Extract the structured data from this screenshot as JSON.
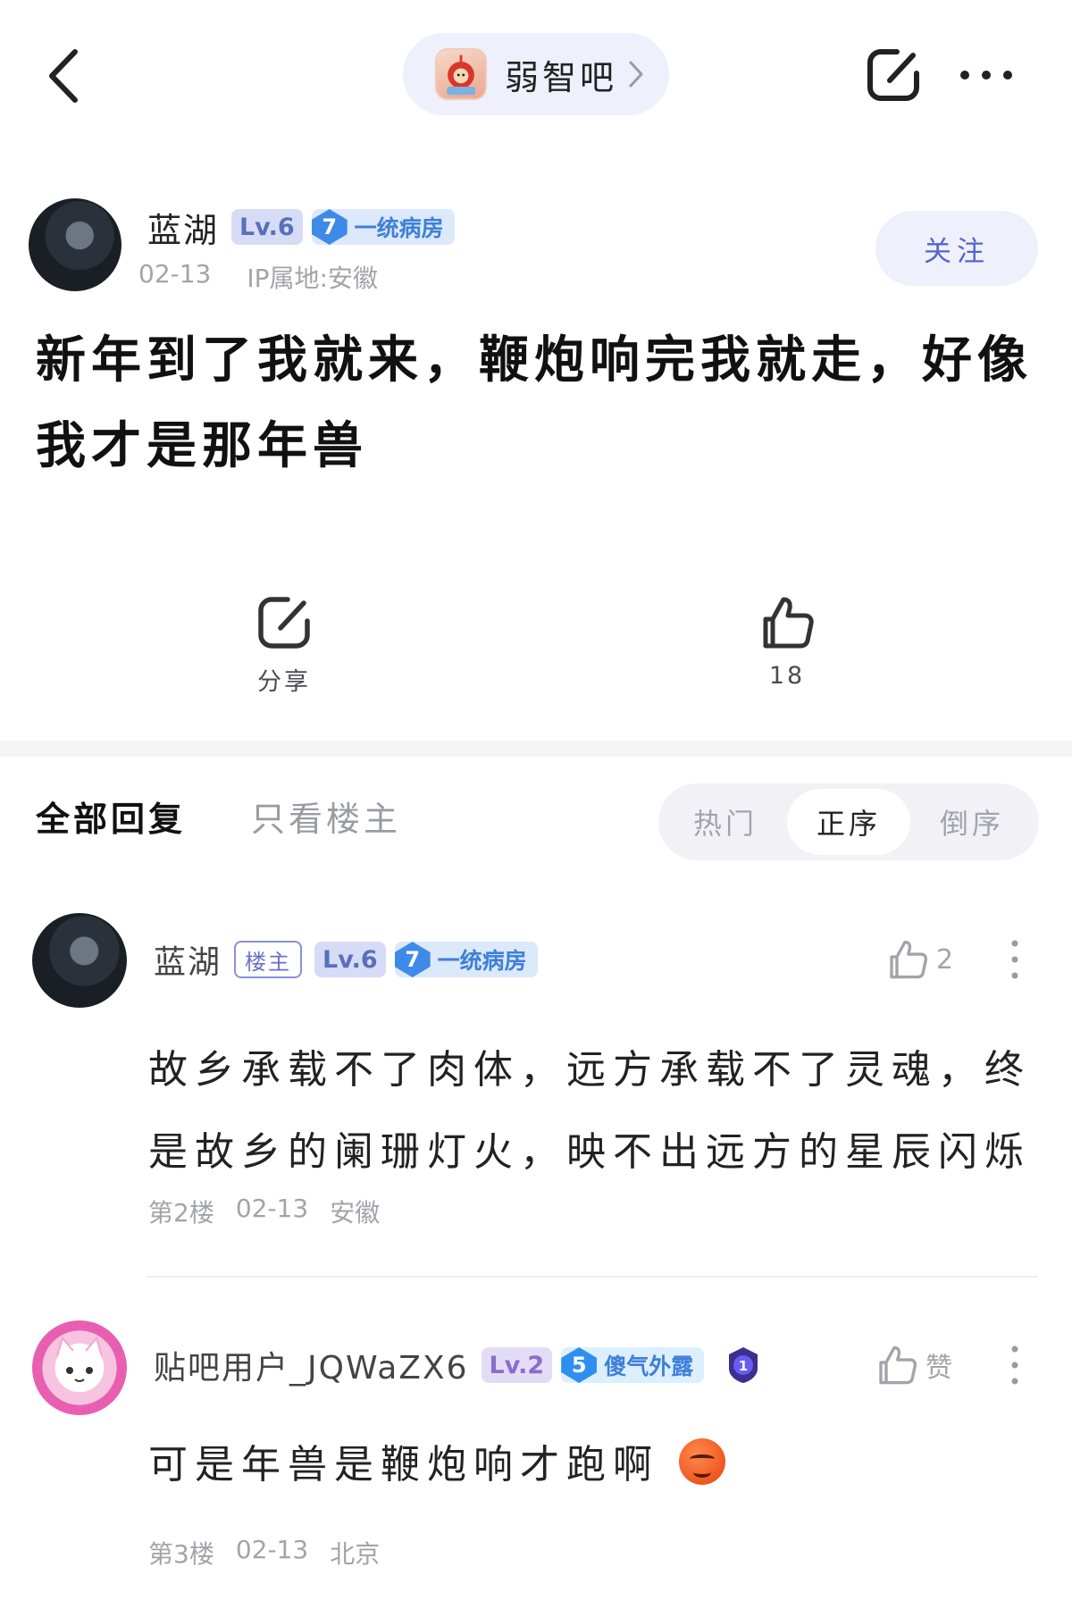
{
  "topbar": {
    "forum_name": "弱智吧",
    "icons": [
      "back-icon",
      "chevron-right-icon",
      "share-icon",
      "more-icon"
    ]
  },
  "post": {
    "author": "蓝湖",
    "level": "Lv.6",
    "rank_number": "7",
    "rank_title": "一统病房",
    "date": "02-13",
    "ip": "IP属地:安徽",
    "follow_label": "关注",
    "title": "新年到了我就来，鞭炮响完我就走，好像我才是那年兽",
    "share_label": "分享",
    "like_count": "18"
  },
  "tabs": {
    "all": "全部回复",
    "op_only": "只看楼主",
    "sort": [
      "热门",
      "正序",
      "倒序"
    ],
    "sort_active": "正序"
  },
  "replies": [
    {
      "name": "蓝湖",
      "op_tag": "楼主",
      "level": "Lv.6",
      "rank_number": "7",
      "rank_title": "一统病房",
      "likes": "2",
      "text": "故乡承载不了肉体，远方承载不了灵魂，终是故乡的阑珊灯火，映不出远方的星辰闪烁",
      "floor": "第2楼",
      "date": "02-13",
      "location": "安徽"
    },
    {
      "name": "贴吧用户_JQWaZX6",
      "level": "Lv.2",
      "rank_number": "5",
      "rank_title": "傻气外露",
      "medal_number": "1",
      "likes": "赞",
      "text": "可是年兽是鞭炮响才跑啊",
      "floor": "第3楼",
      "date": "02-13",
      "location": "北京"
    }
  ],
  "colors": {
    "accent": "#5565c9",
    "pill_bg": "#eef0fb",
    "muted": "#a3a3ab",
    "rank_blue": "#3f8ae8"
  }
}
